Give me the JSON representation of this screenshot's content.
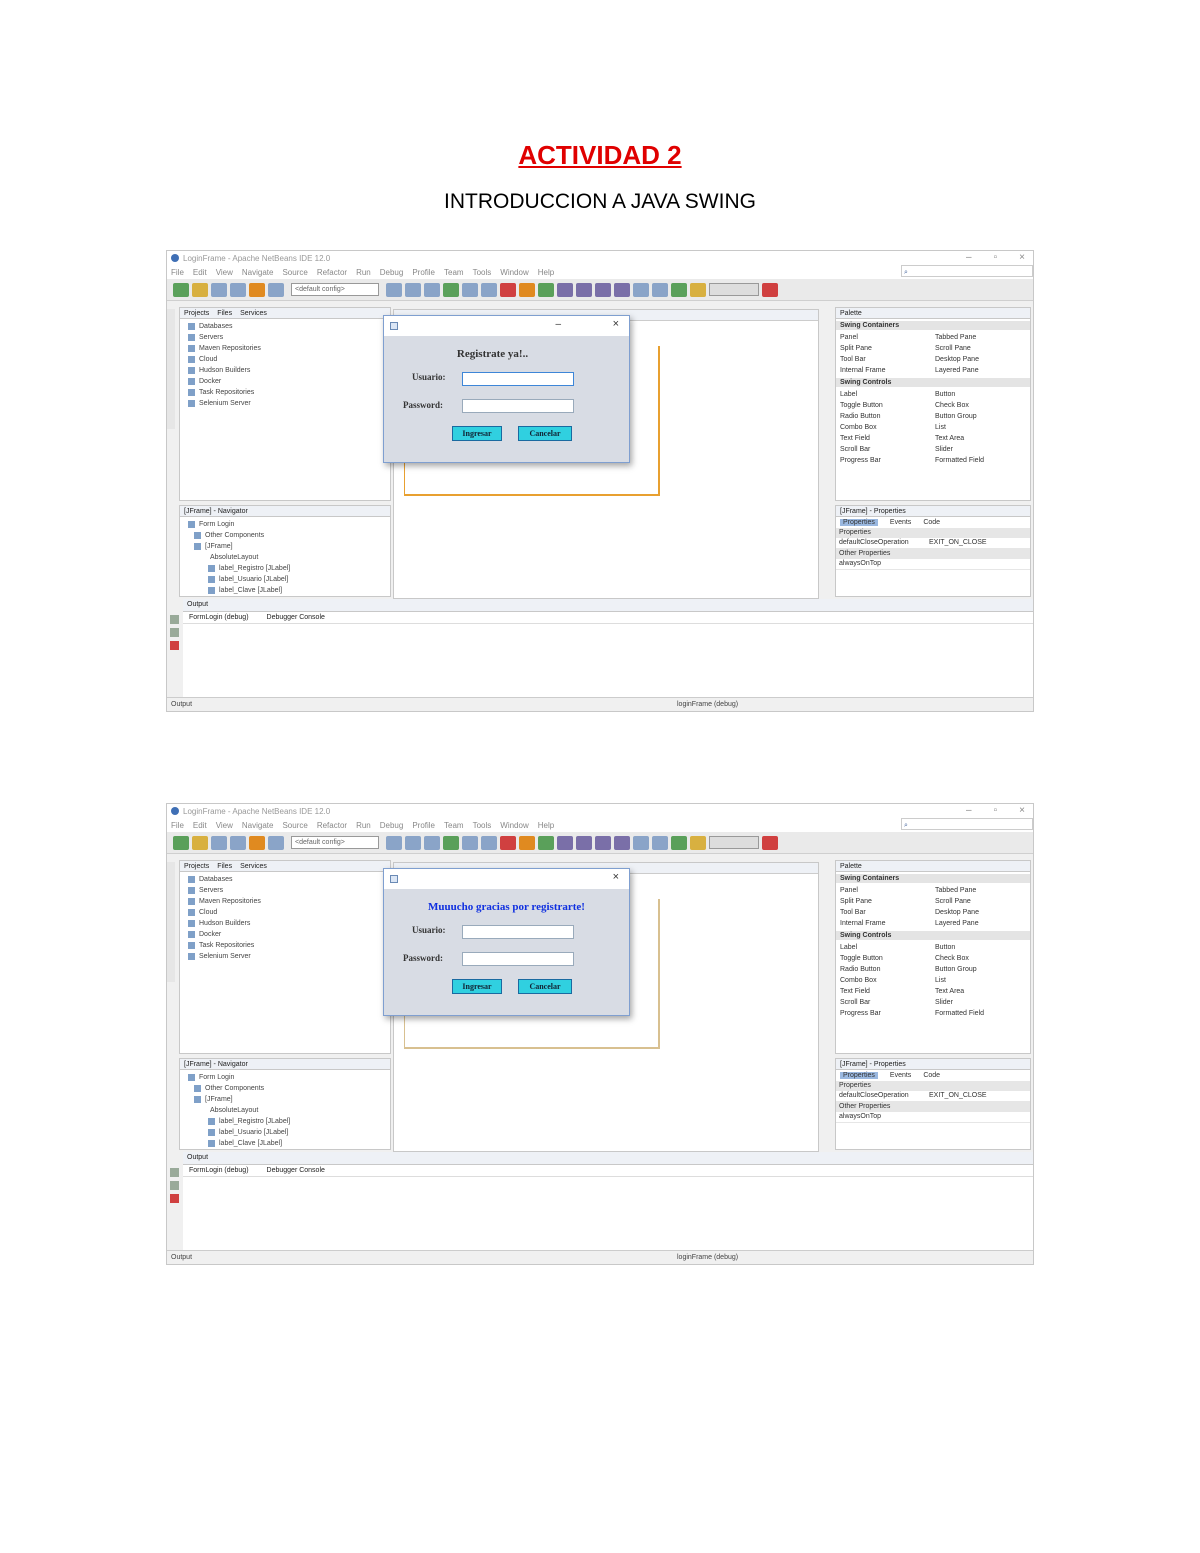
{
  "document": {
    "title": "ACTIVIDAD 2",
    "subtitle": "INTRODUCCION A JAVA SWING"
  },
  "ide": {
    "menus": [
      "File",
      "Edit",
      "View",
      "Navigate",
      "Source",
      "Refactor",
      "Run",
      "Debug",
      "Profile",
      "Team",
      "Tools",
      "Window",
      "Help"
    ],
    "config": "<default config>",
    "projects_tabs": [
      "Projects",
      "Files",
      "Services"
    ],
    "services": [
      "Databases",
      "Servers",
      "Maven Repositories",
      "Cloud",
      "Hudson Builders",
      "Docker",
      "Task Repositories",
      "Selenium Server"
    ],
    "navigator_title": "[JFrame] - Navigator",
    "navigator_items": [
      "Form Login",
      "Other Components",
      "[JFrame]",
      "AbsoluteLayout",
      "label_Registro [JLabel]",
      "label_Usuario [JLabel]",
      "label_Clave [JLabel]"
    ],
    "palette_title": "Palette",
    "swing_containers_title": "Swing Containers",
    "swing_containers": [
      "Panel",
      "Tabbed Pane",
      "Split Pane",
      "Scroll Pane",
      "Tool Bar",
      "Desktop Pane",
      "Internal Frame",
      "Layered Pane"
    ],
    "swing_controls_title": "Swing Controls",
    "swing_controls": [
      "Label",
      "Button",
      "Toggle Button",
      "Check Box",
      "Radio Button",
      "Button Group",
      "Combo Box",
      "List",
      "Text Field",
      "Text Area",
      "Scroll Bar",
      "Slider",
      "Progress Bar",
      "Formatted Field"
    ],
    "properties_title": "[JFrame] - Properties",
    "properties_tabs": [
      "Properties",
      "Events",
      "Code"
    ],
    "properties_section": "Properties",
    "prop_key": "defaultCloseOperation",
    "prop_value": "EXIT_ON_CLOSE",
    "other_props": "Other Properties",
    "always_on_top": "alwaysOnTop",
    "output_title": "Output",
    "output_tabs": [
      "FormLogin (debug)",
      "Debugger Console"
    ],
    "status_left": "Output",
    "status_mid": "loginFrame (debug)"
  },
  "dialog": {
    "usuario_label": "Usuario:",
    "password_label": "Password:",
    "ingresar_label": "Ingresar",
    "cancelar_label": "Cancelar"
  },
  "shot1": {
    "window_title": "LoginFrame - Apache NetBeans IDE 12.0",
    "dialog_message": "Registrate ya!..",
    "message_color": "#333333"
  },
  "shot2": {
    "window_title": "LoginFrame - Apache NetBeans IDE 12.0",
    "dialog_message": "Muuucho gracias por registrarte!",
    "message_color": "#1030e0"
  }
}
